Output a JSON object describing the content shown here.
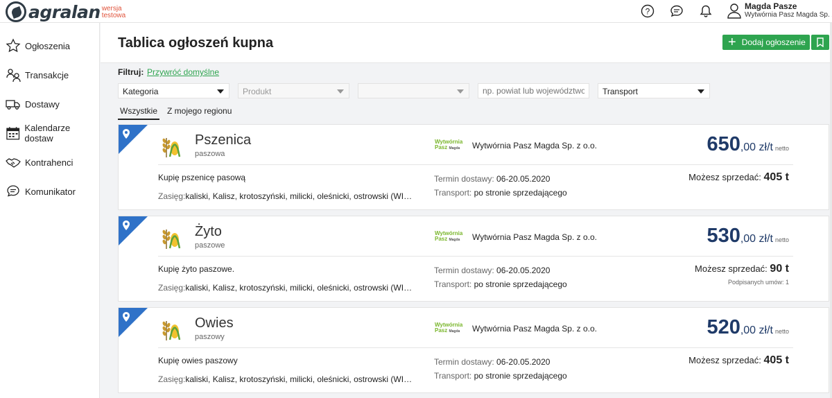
{
  "brand": {
    "name": "agralan",
    "badge_line1": "wersja",
    "badge_line2": "testowa"
  },
  "topbar": {
    "icons": [
      "help-icon",
      "chat-icon",
      "bell-icon",
      "user-icon"
    ],
    "user_name": "Magda Pasze",
    "user_company": "Wytwórnia Pasz Magda Sp. z o.o."
  },
  "sidebar": {
    "items": [
      {
        "label": "Ogłoszenia",
        "icon": "star-icon"
      },
      {
        "label": "Transakcje",
        "icon": "transactions-icon"
      },
      {
        "label": "Dostawy",
        "icon": "truck-icon"
      },
      {
        "label": "Kalendarze dostaw",
        "icon": "calendar-icon"
      },
      {
        "label": "Kontrahenci",
        "icon": "handshake-icon"
      },
      {
        "label": "Komunikator",
        "icon": "chat-icon"
      }
    ]
  },
  "header": {
    "title": "Tablica ogłoszeń kupna",
    "add_button": "Dodaj ogłoszenie"
  },
  "filters": {
    "label": "Filtruj:",
    "reset_link": "Przywróć domyślne",
    "category": "Kategoria",
    "product": "Produkt",
    "variant": "",
    "location_placeholder": "np. powiat lub województwo",
    "transport": "Transport"
  },
  "tabs": {
    "all": "Wszystkie",
    "region": "Z mojego regionu"
  },
  "colors": {
    "green": "#2ea44f",
    "price_blue": "#1f3a68",
    "pin_blue": "#2f72c8"
  },
  "listings": [
    {
      "product": "Pszenica",
      "variant": "paszowa",
      "company_logo_line1": "Wytwórnia",
      "company_logo_line2": "Pasz",
      "company_logo_line3": "Magda",
      "company": "Wytwórnia Pasz Magda Sp. z o.o.",
      "price_main": "650",
      "price_rest": ",00 zł/t",
      "price_note": "netto",
      "description": "Kupię pszenicę pasową",
      "range_label": "Zasięg:",
      "range": "kaliski, Kalisz, krotoszyński, milicki, oleśnicki, ostrowski (WIE), ostrzeszowski",
      "term_label": "Termin dostawy:",
      "term": "06-20.05.2020",
      "transport_label": "Transport:",
      "transport": "po stronie sprzedającego",
      "sell_label": "Możesz sprzedać:",
      "sell_amount": "405 t",
      "signed": ""
    },
    {
      "product": "Żyto",
      "variant": "paszowe",
      "company_logo_line1": "Wytwórnia",
      "company_logo_line2": "Pasz",
      "company_logo_line3": "Magda",
      "company": "Wytwórnia Pasz Magda Sp. z o.o.",
      "price_main": "530",
      "price_rest": ",00 zł/t",
      "price_note": "netto",
      "description": "Kupię żyto paszowe.",
      "range_label": "Zasięg:",
      "range": "kaliski, Kalisz, krotoszyński, milicki, oleśnicki, ostrowski (WIE), ostrzeszowski",
      "term_label": "Termin dostawy:",
      "term": "06-20.05.2020",
      "transport_label": "Transport:",
      "transport": "po stronie sprzedającego",
      "sell_label": "Możesz sprzedać:",
      "sell_amount": "90 t",
      "signed": "Podpisanych umów: 1"
    },
    {
      "product": "Owies",
      "variant": "paszowy",
      "company_logo_line1": "Wytwórnia",
      "company_logo_line2": "Pasz",
      "company_logo_line3": "Magda",
      "company": "Wytwórnia Pasz Magda Sp. z o.o.",
      "price_main": "520",
      "price_rest": ",00 zł/t",
      "price_note": "netto",
      "description": "Kupię owies paszowy",
      "range_label": "Zasięg:",
      "range": "kaliski, Kalisz, krotoszyński, milicki, oleśnicki, ostrowski (WIE), ostrzeszowski",
      "term_label": "Termin dostawy:",
      "term": "06-20.05.2020",
      "transport_label": "Transport:",
      "transport": "po stronie sprzedającego",
      "sell_label": "Możesz sprzedać:",
      "sell_amount": "405 t",
      "signed": ""
    }
  ]
}
